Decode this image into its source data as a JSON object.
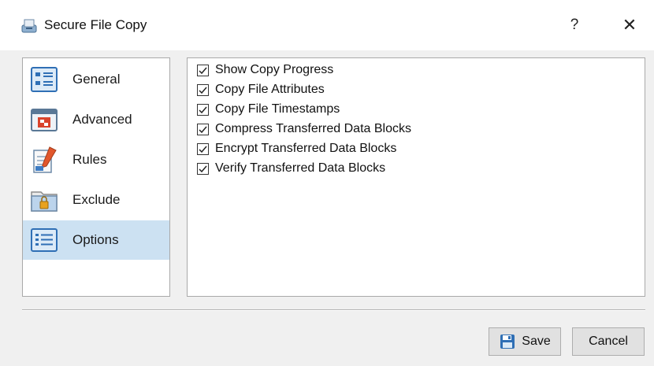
{
  "window": {
    "title": "Secure File Copy",
    "help_glyph": "?",
    "close_glyph": "✕"
  },
  "nav": {
    "items": [
      {
        "label": "General",
        "icon": "general-icon",
        "selected": false
      },
      {
        "label": "Advanced",
        "icon": "advanced-icon",
        "selected": false
      },
      {
        "label": "Rules",
        "icon": "rules-icon",
        "selected": false
      },
      {
        "label": "Exclude",
        "icon": "exclude-folder-lock-icon",
        "selected": false
      },
      {
        "label": "Options",
        "icon": "options-list-icon",
        "selected": true
      }
    ]
  },
  "options": {
    "items": [
      {
        "label": "Show Copy Progress",
        "checked": true
      },
      {
        "label": "Copy File Attributes",
        "checked": true
      },
      {
        "label": "Copy File Timestamps",
        "checked": true
      },
      {
        "label": "Compress Transferred Data Blocks",
        "checked": true
      },
      {
        "label": "Encrypt Transferred Data Blocks",
        "checked": true
      },
      {
        "label": "Verify Transferred Data Blocks",
        "checked": true
      }
    ]
  },
  "buttons": {
    "save_label": "Save",
    "cancel_label": "Cancel"
  },
  "colors": {
    "selected_bg": "#cce1f2",
    "accent": "#2f6fb5"
  }
}
